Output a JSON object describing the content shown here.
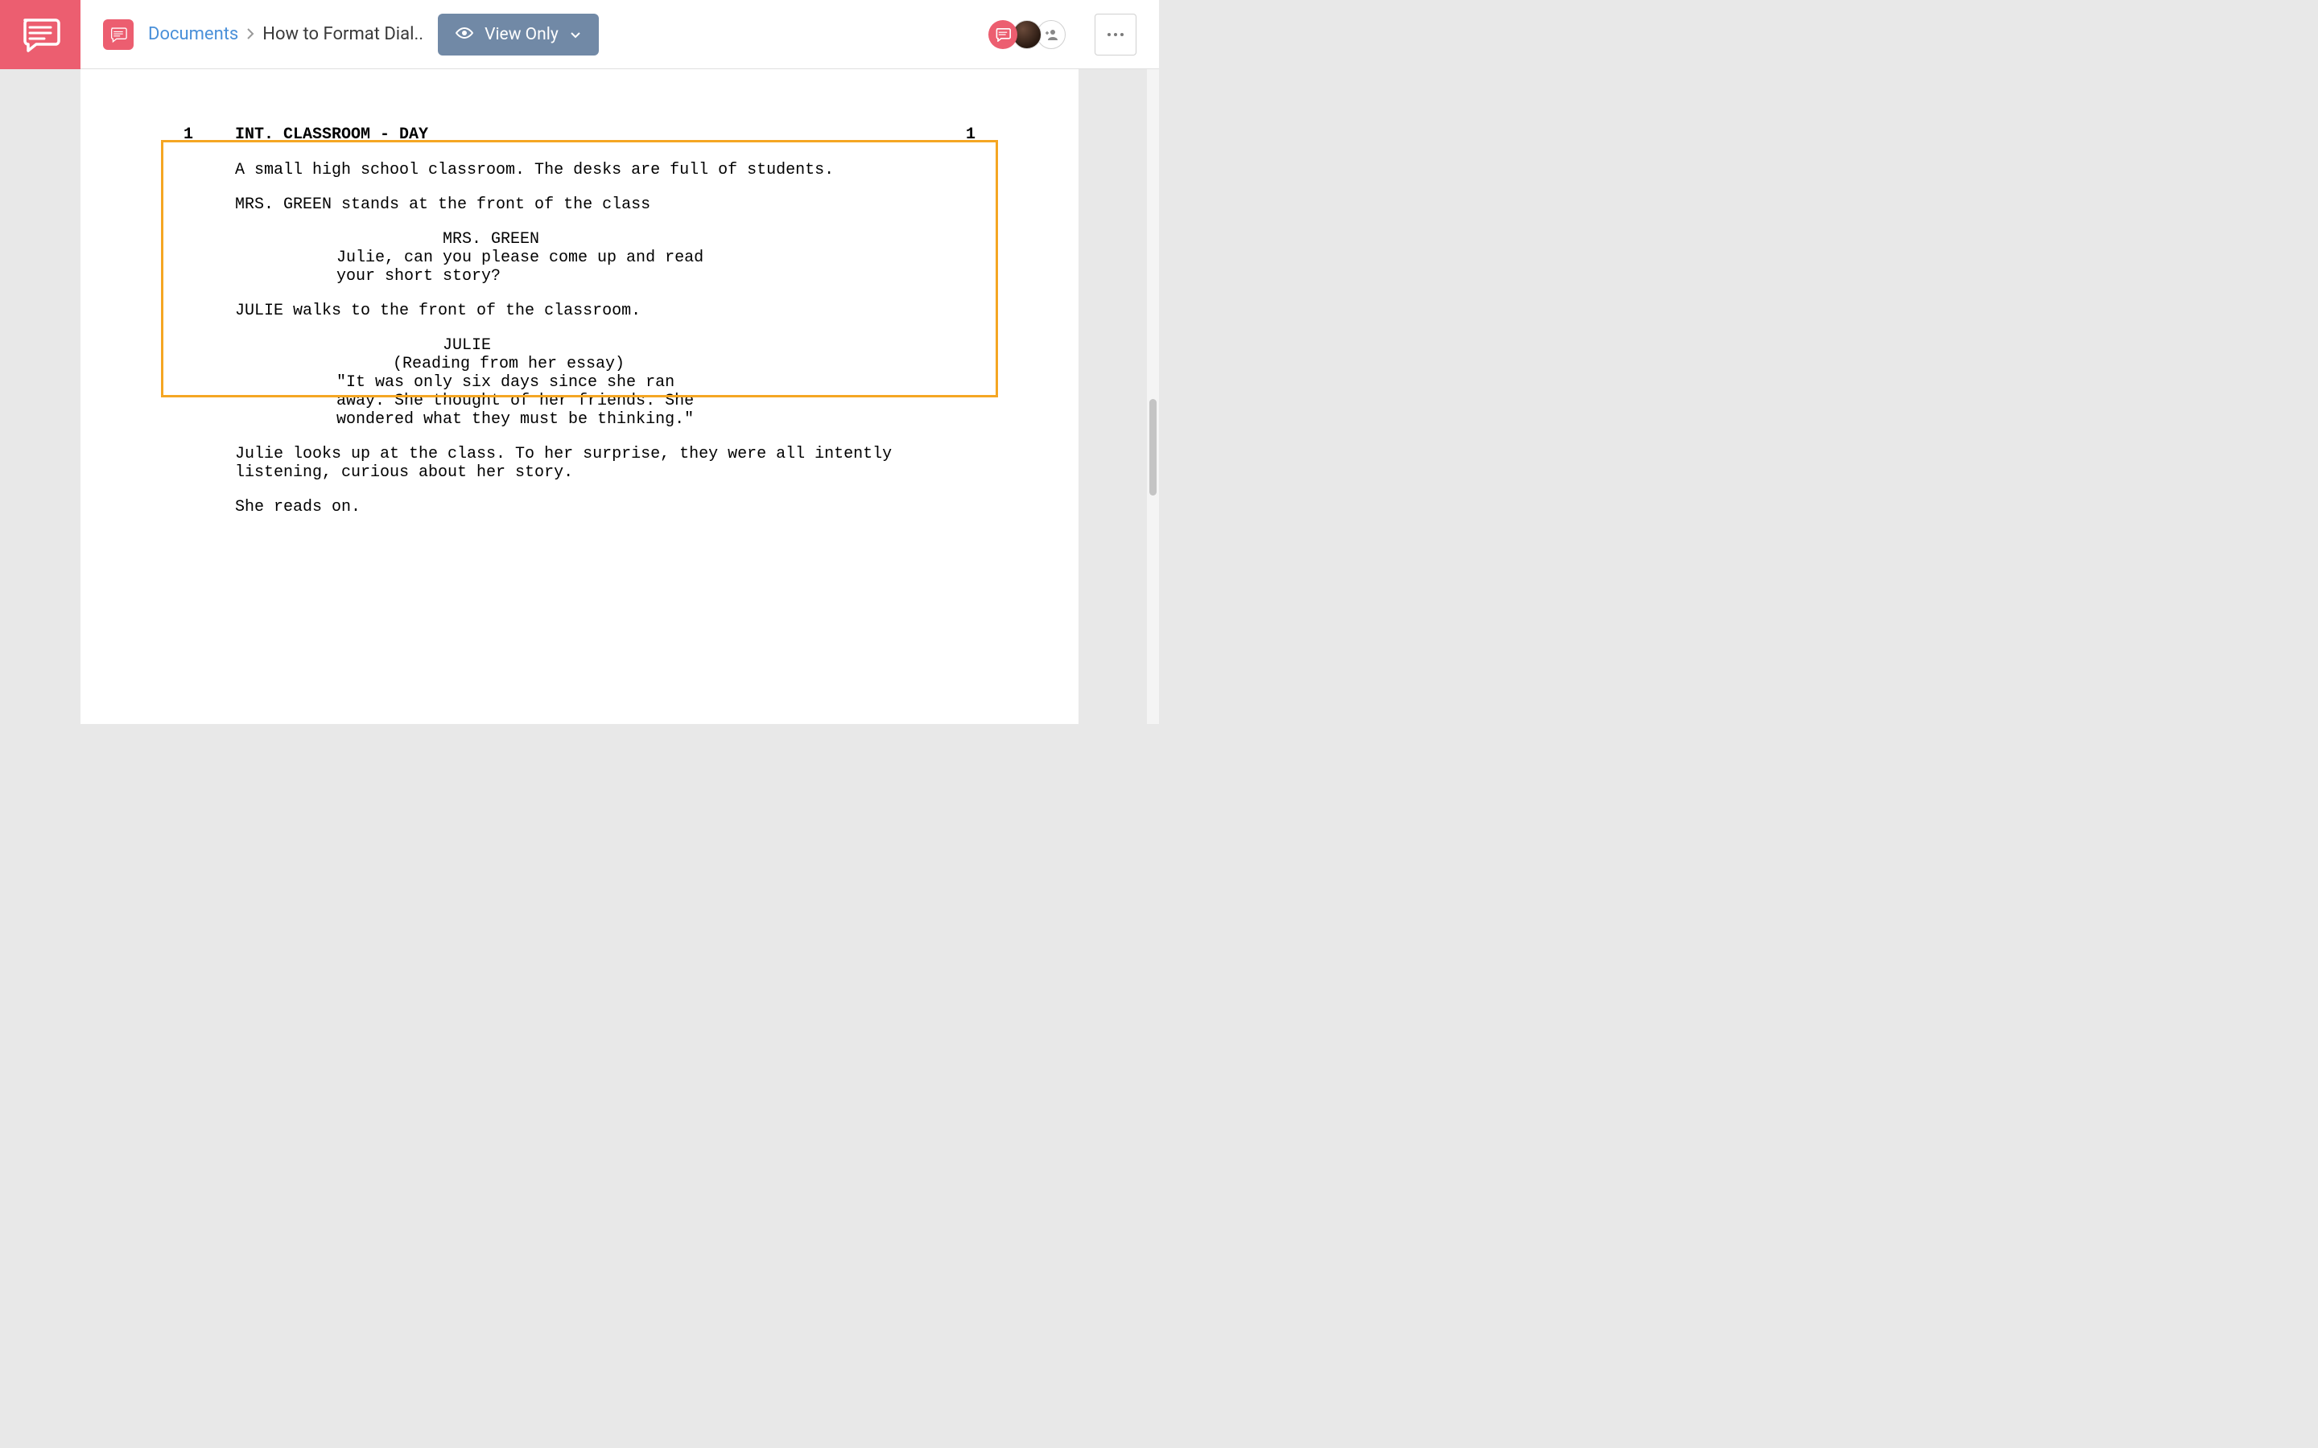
{
  "breadcrumb": {
    "root": "Documents",
    "current": "How to Format Dial.."
  },
  "toolbar": {
    "view_label": "View Only"
  },
  "scene": {
    "number_left": "1",
    "number_right": "1",
    "slugline": "INT. CLASSROOM - DAY",
    "action1": "A small high school classroom. The desks are full of students.",
    "action2": "MRS. GREEN stands at the front of the class",
    "char1": "MRS. GREEN",
    "dialog1": "Julie, can you please come up and read your short story?",
    "action3": "JULIE walks to the front of the classroom.",
    "char2": "JULIE",
    "paren2": "(Reading from her essay)",
    "dialog2": "\"It was only six days since she ran away. She thought of her friends. She wondered what they must be thinking.\"",
    "action4": "Julie looks up at the class. To her surprise, they were all intently listening, curious about her story.",
    "action5": "She reads on."
  }
}
